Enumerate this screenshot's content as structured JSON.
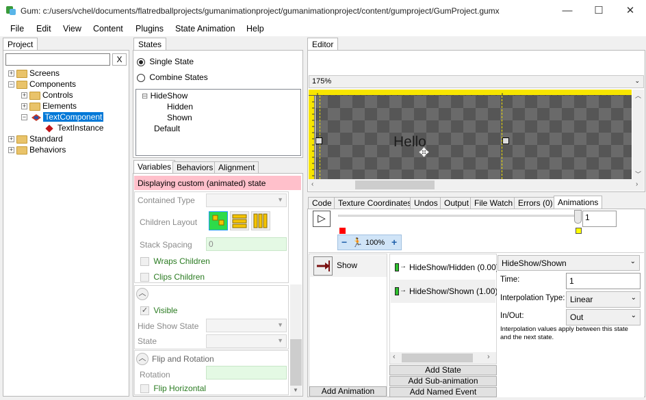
{
  "window": {
    "title": "Gum: c:/users/vchel/documents/flatredballprojects/gumanimationproject/gumanimationproject/content/gumproject/GumProject.gumx",
    "minimize": "—",
    "maximize": "☐",
    "close": "✕"
  },
  "menu": [
    "File",
    "Edit",
    "View",
    "Content",
    "Plugins",
    "State Animation",
    "Help"
  ],
  "project": {
    "tab": "Project",
    "search_value": "",
    "clear_label": "X",
    "tree": [
      "Screens",
      "Components",
      "Controls",
      "Elements",
      "TextComponent",
      "TextInstance",
      "Standard",
      "Behaviors"
    ]
  },
  "states": {
    "tab": "States",
    "single_state": "Single State",
    "combine_states": "Combine States",
    "tree": [
      "HideShow",
      "Hidden",
      "Shown",
      "Default"
    ]
  },
  "properties": {
    "tabs": [
      "Variables",
      "Behaviors",
      "Alignment"
    ],
    "banner": "Displaying custom (animated) state",
    "contained_type": "Contained Type",
    "children_layout": "Children Layout",
    "stack_spacing": "Stack Spacing",
    "stack_spacing_value": "0",
    "wraps_children": "Wraps Children",
    "clips_children": "Clips Children",
    "visible": "Visible",
    "hide_show_state": "Hide Show State",
    "state": "State",
    "flip_rotation": "Flip and Rotation",
    "rotation": "Rotation",
    "flip_horizontal": "Flip Horizontal"
  },
  "editor": {
    "tab": "Editor",
    "zoom": "175%",
    "canvas_text": "Hello"
  },
  "bottom_tabs": [
    "Code",
    "Texture Coordinates",
    "Undos",
    "Output",
    "File Watch",
    "Errors (0)",
    "Animations"
  ],
  "animations": {
    "timeline_value": "1",
    "speed": "100%",
    "animation_list": [
      "Show"
    ],
    "add_animation": "Add Animation",
    "keyframes": [
      "HideShow/Hidden (0.00)",
      "HideShow/Shown (1.00)"
    ],
    "add_state": "Add State",
    "add_sub_animation": "Add Sub-animation",
    "add_named_event": "Add Named Event",
    "selected_state": "HideShow/Shown",
    "time_label": "Time:",
    "time_value": "1",
    "interp_label": "Interpolation Type:",
    "interp_value": "Linear",
    "inout_label": "In/Out:",
    "inout_value": "Out",
    "note": "Interpolation values apply between this state and the next state."
  }
}
